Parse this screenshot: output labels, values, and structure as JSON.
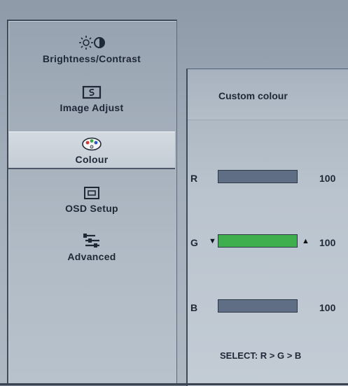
{
  "menu": {
    "items": [
      {
        "label": "Brightness/Contrast",
        "icon": "brightness-contrast-icon",
        "selected": false
      },
      {
        "label": "Image Adjust",
        "icon": "image-adjust-icon",
        "selected": false
      },
      {
        "label": "Colour",
        "icon": "palette-icon",
        "selected": true
      },
      {
        "label": "OSD Setup",
        "icon": "osd-setup-icon",
        "selected": false
      },
      {
        "label": "Advanced",
        "icon": "advanced-settings-icon",
        "selected": false
      }
    ]
  },
  "submenu": {
    "title": "Custom colour",
    "channels": [
      {
        "label": "R",
        "value": "100",
        "level": 1.0,
        "active": false,
        "bar_color": "#5f6d85"
      },
      {
        "label": "G",
        "value": "100",
        "level": 1.0,
        "active": true,
        "bar_color": "#3fae4c"
      },
      {
        "label": "B",
        "value": "100",
        "level": 1.0,
        "active": false,
        "bar_color": "#5f6d85"
      }
    ],
    "select_hint": "SELECT: R > G > B"
  },
  "colors": {
    "panel_bg": "#b0bac5",
    "selected_bg": "#d0d7de",
    "active_slider": "#3fae4c",
    "inactive_slider": "#5f6d85",
    "text": "#1f2836"
  }
}
